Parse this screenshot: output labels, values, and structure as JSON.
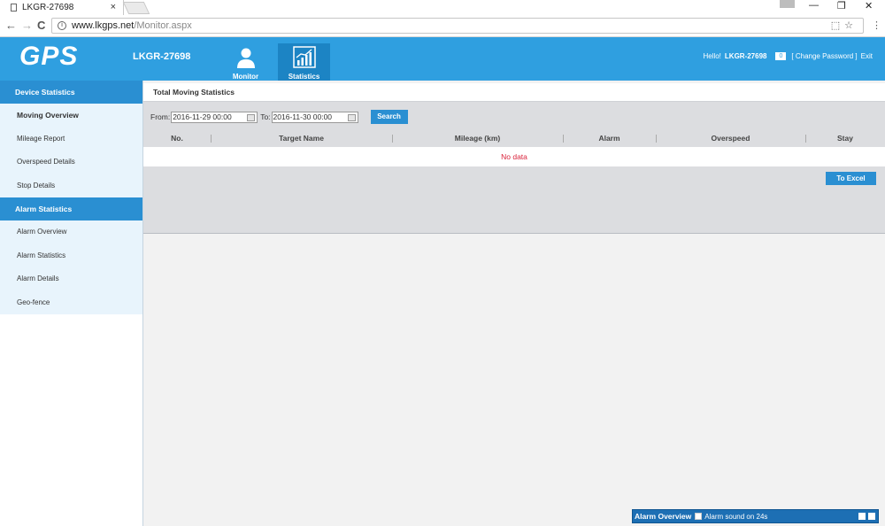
{
  "browser": {
    "tab_title": "LKGR-27698",
    "tab_close": "×",
    "url_host": "www.lkgps.net",
    "url_path": "/Monitor.aspx",
    "back": "←",
    "forward": "→",
    "reload": "C",
    "info": "i",
    "menu": "⋮",
    "min": "—",
    "restore": "❐",
    "close": "✕",
    "omni_icons": "⬚☆"
  },
  "header": {
    "logo": "GPS",
    "account": "LKGR-27698",
    "nav": [
      {
        "label": "Monitor",
        "icon": "user-icon"
      },
      {
        "label": "Statistics",
        "icon": "chart-icon",
        "active": true
      }
    ],
    "hello_prefix": "Hello!",
    "hello_user": "LKGR-27698",
    "message_count": "0",
    "change_password": "[ Change Password ]",
    "exit": "Exit"
  },
  "sidebar": {
    "groups": [
      {
        "title": "Device Statistics",
        "items": [
          "Moving Overview",
          "Mileage Report",
          "Overspeed Details",
          "Stop Details"
        ]
      },
      {
        "title": "Alarm Statistics",
        "items": [
          "Alarm Overview",
          "Alarm Statistics",
          "Alarm Details",
          "Geo-fence"
        ]
      }
    ],
    "active_item": "Moving Overview"
  },
  "main": {
    "title": "Total Moving Statistics",
    "from_label": "From:",
    "from_value": "2016-11-29 00:00",
    "to_label": "To:",
    "to_value": "2016-11-30 00:00",
    "search_label": "Search",
    "columns": [
      "No.",
      "Target Name",
      "Mileage (km)",
      "Alarm",
      "Overspeed",
      "Stay"
    ],
    "empty_text": "No data",
    "excel_label": "To Excel"
  },
  "alarm_bar": {
    "title": "Alarm Overview",
    "sound_label": "Alarm sound on 24s"
  },
  "colors": {
    "header": "#2f9fe0",
    "accent": "#2a8fd2",
    "no_data": "#d9233b",
    "sidebar_bg": "#e8f4fc"
  }
}
